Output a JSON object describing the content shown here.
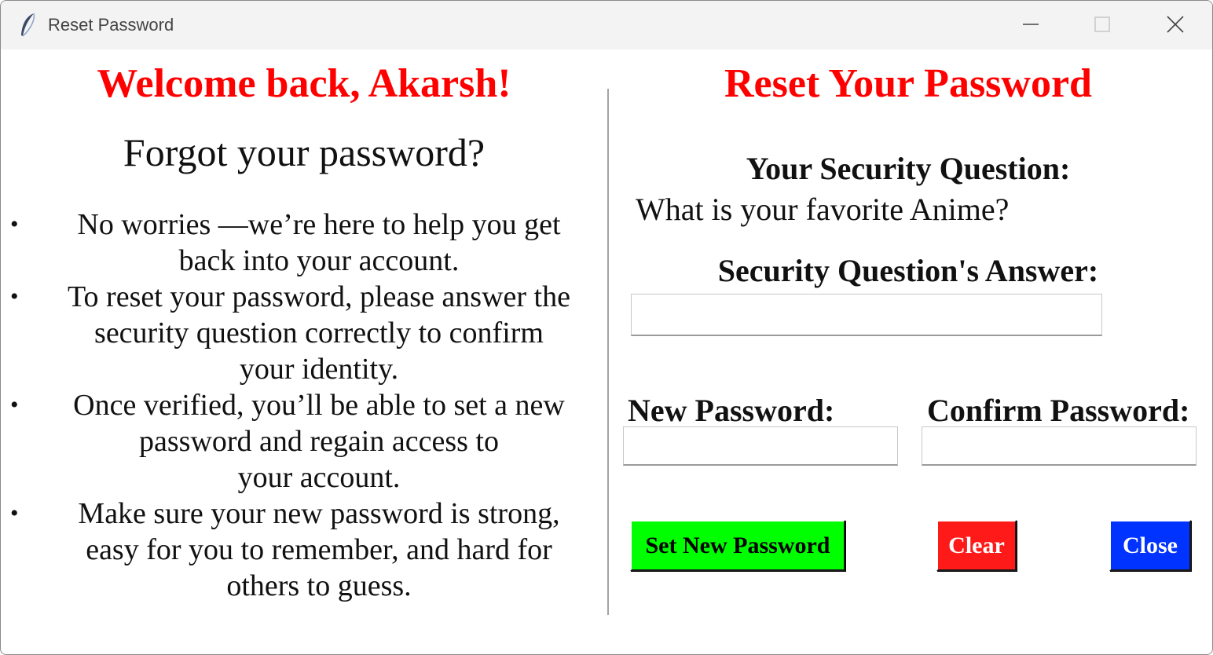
{
  "window": {
    "title": "Reset Password",
    "app_icon": "feather-icon"
  },
  "left_panel": {
    "welcome": "Welcome back, Akarsh!",
    "forgot": "Forgot your password?",
    "bullets": [
      "No worries —we’re here to help you get\nback into your account.",
      "To reset your password, please answer the\nsecurity question correctly to confirm\nyour identity.",
      "Once verified, you’ll be able to set a new\npassword and regain access to\nyour account.",
      "Make sure your new password is strong,\neasy for you to remember, and hard for\nothers to guess."
    ],
    "bullet_glyph": "•"
  },
  "right_panel": {
    "title": "Reset Your Password",
    "security_question_label": "Your Security Question:",
    "security_question": "What is your favorite Anime?",
    "answer_label": "Security Question's Answer:",
    "answer_value": "",
    "new_password_label": "New Password:",
    "new_password_value": "",
    "confirm_password_label": "Confirm Password:",
    "confirm_password_value": "",
    "buttons": {
      "set": "Set New Password",
      "clear": "Clear",
      "close": "Close"
    }
  },
  "colors": {
    "heading": "#ff0000",
    "set_button_bg": "#00ff00",
    "set_button_fg": "#000000",
    "clear_button_bg": "#ff1a1a",
    "clear_button_fg": "#ffffff",
    "close_button_bg": "#0033ff",
    "close_button_fg": "#ffffff"
  }
}
